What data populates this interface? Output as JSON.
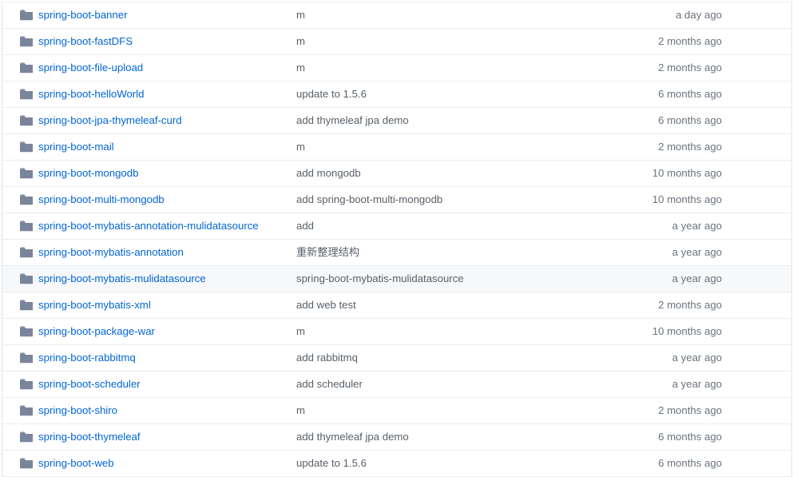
{
  "file_browser": {
    "icon_name": "folder-icon",
    "icon_color": "#79859b",
    "link_color": "#0366d6",
    "message_color": "#586069",
    "age_color": "#6a737d",
    "row_hover_color": "#f6f8fa",
    "border_color": "#eaecef",
    "rows": [
      {
        "name": "spring-boot-banner",
        "message": "m",
        "age": "a day ago",
        "hovered": false
      },
      {
        "name": "spring-boot-fastDFS",
        "message": "m",
        "age": "2 months ago",
        "hovered": false
      },
      {
        "name": "spring-boot-file-upload",
        "message": "m",
        "age": "2 months ago",
        "hovered": false
      },
      {
        "name": "spring-boot-helloWorld",
        "message": "update to 1.5.6",
        "age": "6 months ago",
        "hovered": false
      },
      {
        "name": "spring-boot-jpa-thymeleaf-curd",
        "message": "add thymeleaf jpa demo",
        "age": "6 months ago",
        "hovered": false
      },
      {
        "name": "spring-boot-mail",
        "message": "m",
        "age": "2 months ago",
        "hovered": false
      },
      {
        "name": "spring-boot-mongodb",
        "message": "add mongodb",
        "age": "10 months ago",
        "hovered": false
      },
      {
        "name": "spring-boot-multi-mongodb",
        "message": "add spring-boot-multi-mongodb",
        "age": "10 months ago",
        "hovered": false
      },
      {
        "name": "spring-boot-mybatis-annotation-mulidatasource",
        "message": "add",
        "age": "a year ago",
        "hovered": false
      },
      {
        "name": "spring-boot-mybatis-annotation",
        "message": "重新整理结构",
        "age": "a year ago",
        "hovered": false
      },
      {
        "name": "spring-boot-mybatis-mulidatasource",
        "message": "spring-boot-mybatis-mulidatasource",
        "age": "a year ago",
        "hovered": true
      },
      {
        "name": "spring-boot-mybatis-xml",
        "message": "add web test",
        "age": "2 months ago",
        "hovered": false
      },
      {
        "name": "spring-boot-package-war",
        "message": "m",
        "age": "10 months ago",
        "hovered": false
      },
      {
        "name": "spring-boot-rabbitmq",
        "message": "add rabbitmq",
        "age": "a year ago",
        "hovered": false
      },
      {
        "name": "spring-boot-scheduler",
        "message": "add scheduler",
        "age": "a year ago",
        "hovered": false
      },
      {
        "name": "spring-boot-shiro",
        "message": "m",
        "age": "2 months ago",
        "hovered": false
      },
      {
        "name": "spring-boot-thymeleaf",
        "message": "add thymeleaf jpa demo",
        "age": "6 months ago",
        "hovered": false
      },
      {
        "name": "spring-boot-web",
        "message": "update to 1.5.6",
        "age": "6 months ago",
        "hovered": false
      }
    ]
  }
}
